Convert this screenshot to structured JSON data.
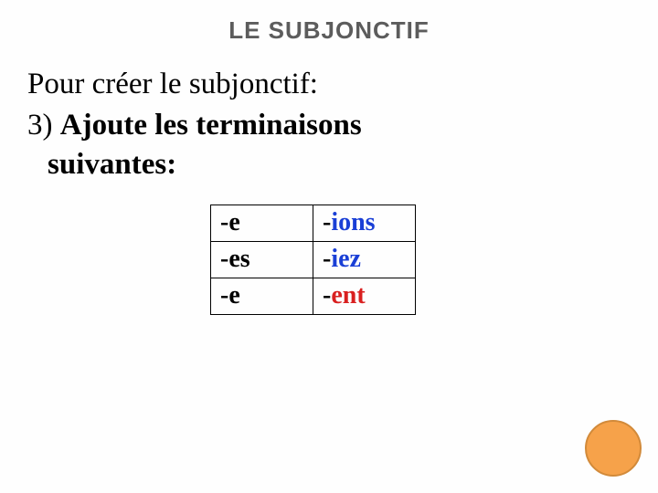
{
  "title": "LE SUBJONCTIF",
  "content": {
    "line1": "Pour créer le subjonctif:",
    "line2_lead": "3) ",
    "line2_bold": "Ajoute les terminaisons",
    "line3": "suivantes:"
  },
  "table": {
    "rows": [
      {
        "left_hyph": "-",
        "left_end": "e",
        "right_hyph": "-",
        "right_end": "ions",
        "right_class": "blue"
      },
      {
        "left_hyph": "-",
        "left_end": "es",
        "right_hyph": "-",
        "right_end": "iez",
        "right_class": "blue"
      },
      {
        "left_hyph": "-",
        "left_end": "e",
        "right_hyph": "-",
        "right_end": "ent",
        "right_class": "red"
      }
    ]
  }
}
